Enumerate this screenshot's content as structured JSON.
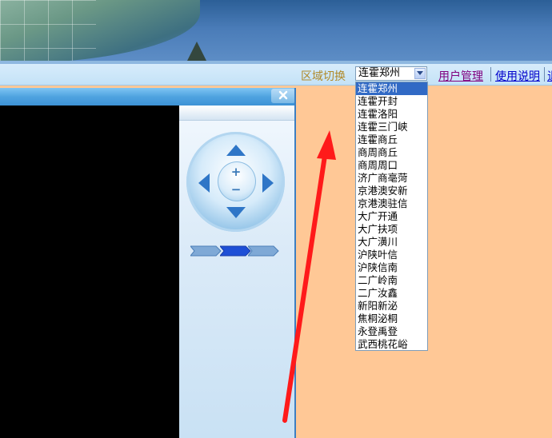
{
  "toolbar": {
    "region_label": "区域切换",
    "selected_region": "连霍郑州",
    "user_mgmt_link": "用户管理",
    "help_link": "使用说明",
    "more_link": "退"
  },
  "dropdown": {
    "options": [
      "连霍郑州",
      "连霍开封",
      "连霍洛阳",
      "连霍三门峡",
      "连霍商丘",
      "商周商丘",
      "商周周口",
      "济广商亳菏",
      "京港澳安新",
      "京港澳驻信",
      "大广开通",
      "大广扶项",
      "大广潢川",
      "沪陕叶信",
      "沪陕信南",
      "二广岭南",
      "二广汝鑫",
      "新阳新泌",
      "焦桐泌桐",
      "永登禹登",
      "武西桃花峪"
    ],
    "highlighted_index": 0
  },
  "colors": {
    "background": "#ffc896",
    "selection": "#316ac5",
    "annotation_arrow": "#ff0000"
  }
}
